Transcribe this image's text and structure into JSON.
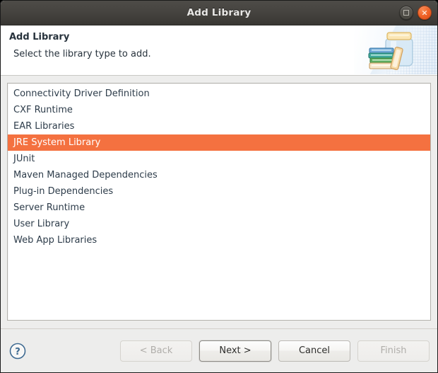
{
  "window": {
    "title": "Add Library",
    "buttons": {
      "maximize_label": "Maximize",
      "close_label": "×"
    }
  },
  "header": {
    "title": "Add Library",
    "subtitle": "Select the library type to add.",
    "art_icon": "library-jar-books-icon"
  },
  "list": {
    "name": "library-type-list",
    "selected_index": 3,
    "items": [
      "Connectivity Driver Definition",
      "CXF Runtime",
      "EAR Libraries",
      "JRE System Library",
      "JUnit",
      "Maven Managed Dependencies",
      "Plug-in Dependencies",
      "Server Runtime",
      "User Library",
      "Web App Libraries"
    ]
  },
  "footer": {
    "help_icon": "help-circle-icon",
    "buttons": [
      {
        "label": "< Back",
        "name": "back-button",
        "state": "disabled"
      },
      {
        "label": "Next >",
        "name": "next-button",
        "state": "default"
      },
      {
        "label": "Cancel",
        "name": "cancel-button",
        "state": "enabled"
      },
      {
        "label": "Finish",
        "name": "finish-button",
        "state": "disabled"
      }
    ]
  },
  "colors": {
    "selection": "#f47140",
    "titlebar": "#45433f",
    "dialog_background": "#ededec",
    "list_background": "#ffffff",
    "text": "#2d3c4a",
    "close_button": "#ee5f24"
  }
}
